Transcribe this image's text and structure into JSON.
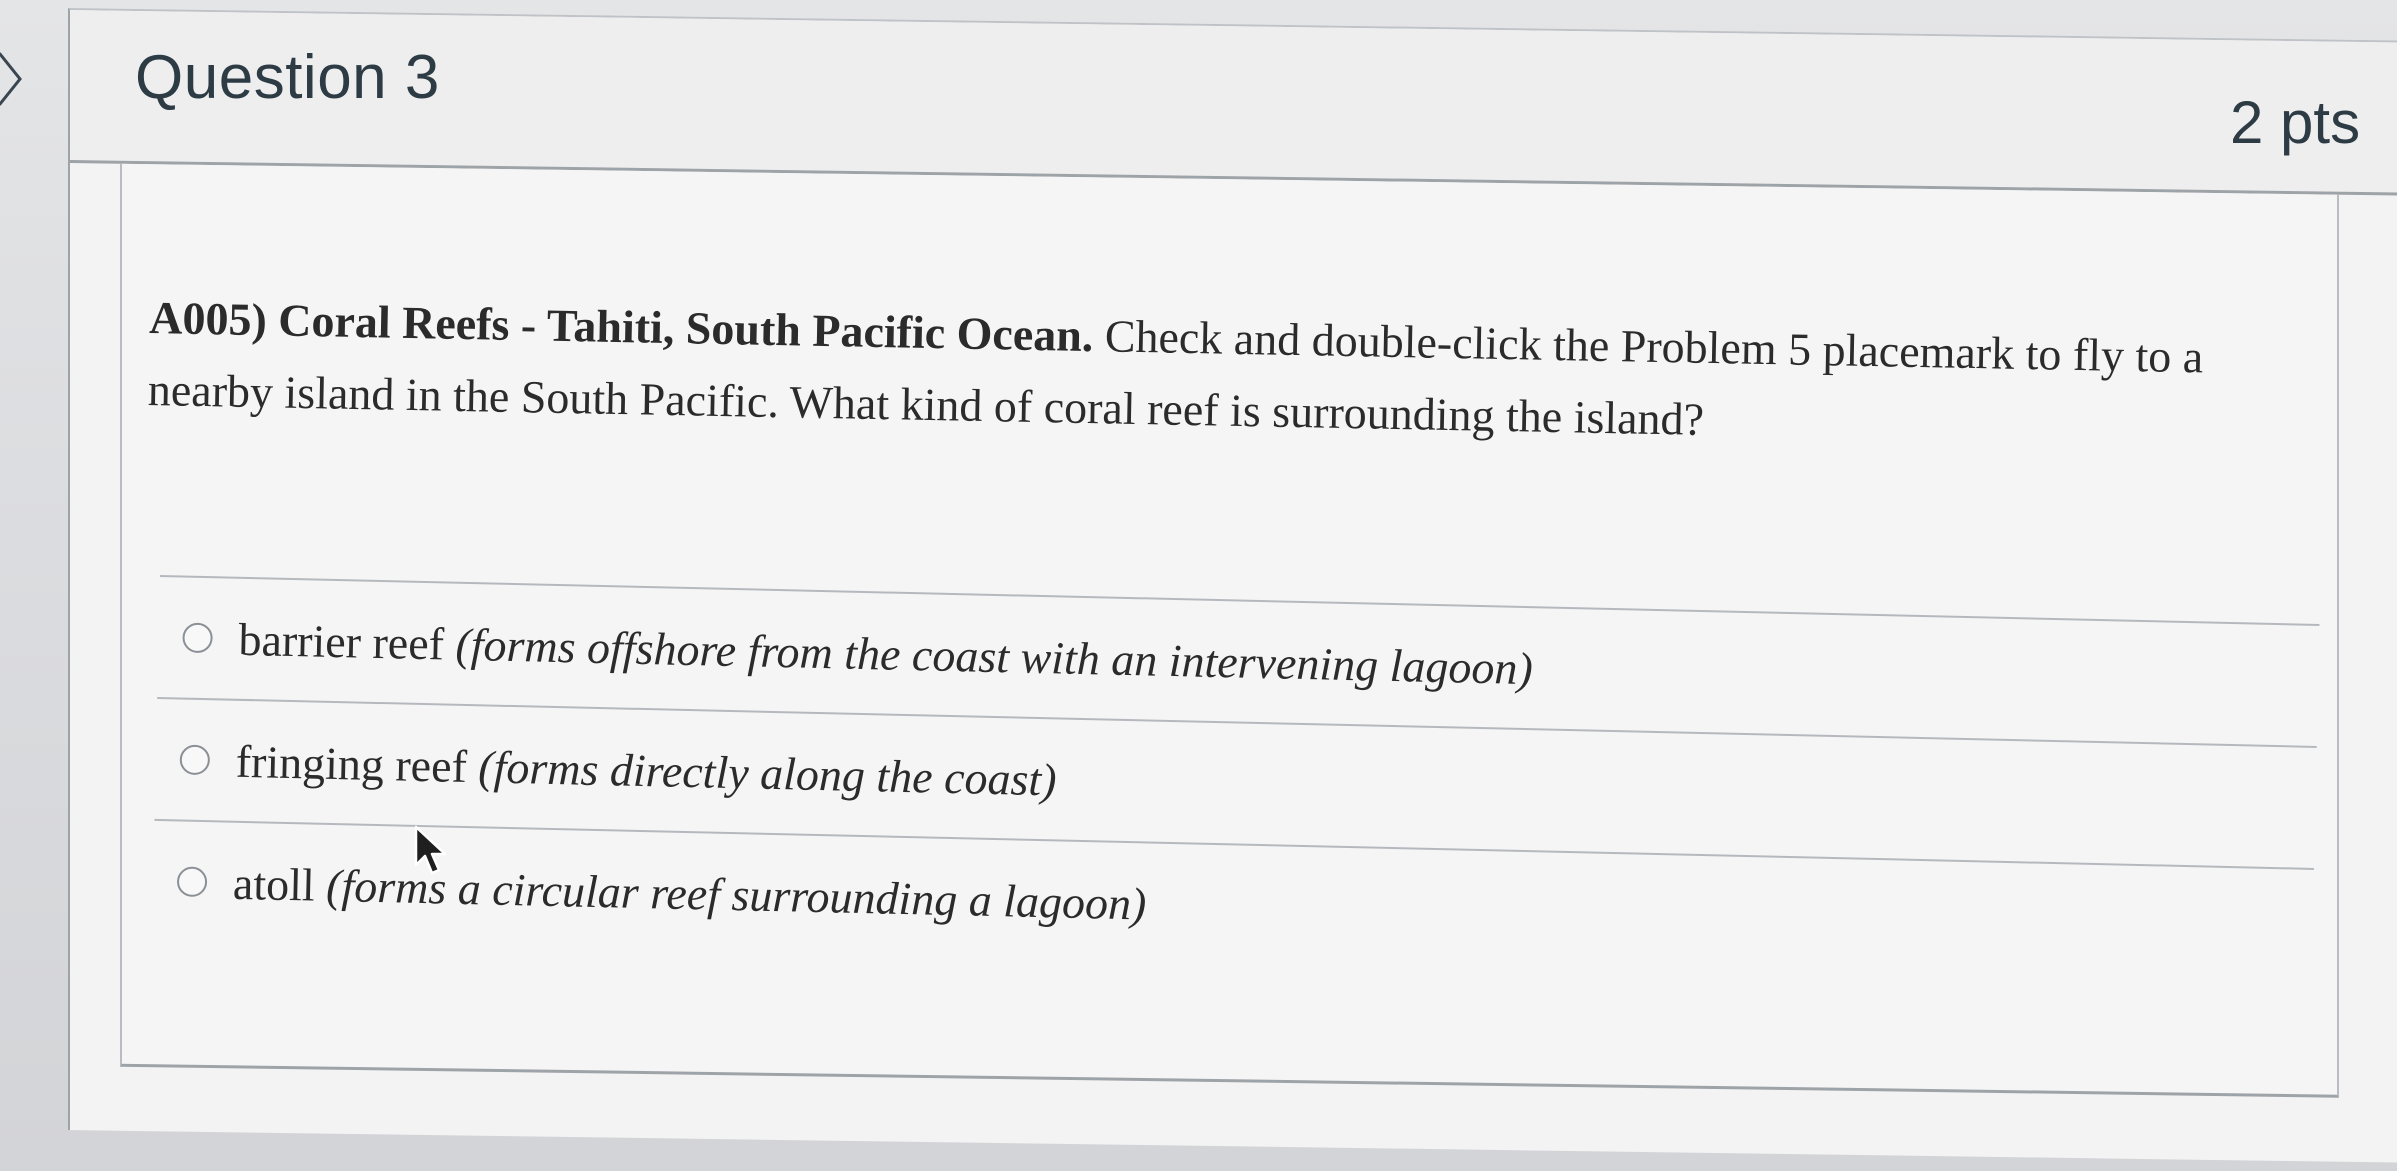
{
  "question": {
    "title": "Question 3",
    "points": "2 pts",
    "text_bold": "A005) Coral Reefs - Tahiti, South Pacific Ocean.",
    "text_rest": " Check and double-click the Problem 5 placemark to fly to a nearby island in the South Pacific.  What kind of coral reef is surrounding the island?"
  },
  "answers": [
    {
      "label": "barrier reef",
      "description": "(forms offshore from the coast with an intervening lagoon)"
    },
    {
      "label": "fringing reef",
      "description": "(forms directly along the coast)"
    },
    {
      "label": "atoll",
      "description": "(forms a circular reef surrounding a lagoon)"
    }
  ],
  "icons": {
    "collapse": "chevron-right-icon",
    "radio": "radio-unchecked-icon",
    "cursor": "mouse-pointer-icon"
  },
  "colors": {
    "text": "#2d3b45",
    "border": "#9ea3a8",
    "background": "#f3f3f3"
  }
}
